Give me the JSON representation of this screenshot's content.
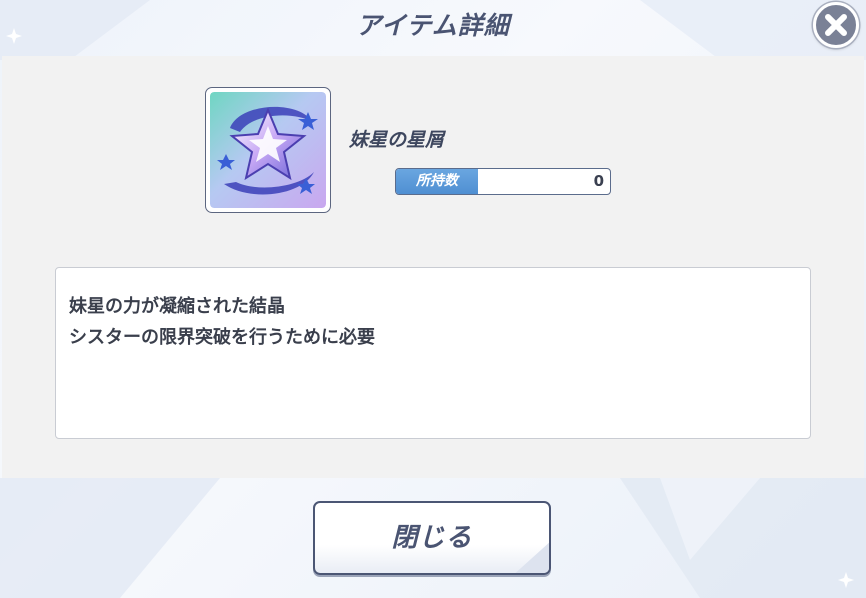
{
  "dialog": {
    "title": "アイテム詳細",
    "close_icon": "close-icon"
  },
  "item": {
    "icon": "star-shard-icon",
    "name": "妹星の星屑",
    "count_label": "所持数",
    "count_value": "0"
  },
  "description": {
    "lines": [
      "妹星の力が凝縮された結晶",
      "シスターの限界突破を行うために必要"
    ]
  },
  "footer": {
    "close_label": "閉じる"
  },
  "colors": {
    "title_text": "#4a5472",
    "accent_blue": "#4f8fd2",
    "frame_border": "#5c6680",
    "content_bg": "#f2f2f2"
  }
}
